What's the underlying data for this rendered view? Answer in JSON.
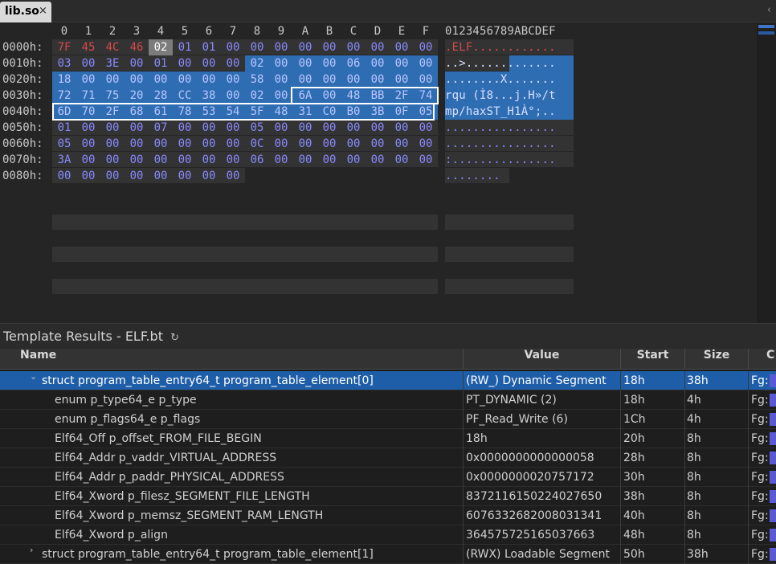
{
  "tab": {
    "title": "lib.so",
    "close": "×",
    "scroll_chevron": "‹"
  },
  "hex": {
    "columns": [
      "0",
      "1",
      "2",
      "3",
      "4",
      "5",
      "6",
      "7",
      "8",
      "9",
      "A",
      "B",
      "C",
      "D",
      "E",
      "F"
    ],
    "ascii_header": "0123456789ABCDEF",
    "rows": [
      {
        "offset": "0000h:",
        "bytes": [
          "7F",
          "45",
          "4C",
          "46",
          "02",
          "01",
          "01",
          "00",
          "00",
          "00",
          "00",
          "00",
          "00",
          "00",
          "00",
          "00"
        ],
        "ascii": ".ELF............"
      },
      {
        "offset": "0010h:",
        "bytes": [
          "03",
          "00",
          "3E",
          "00",
          "01",
          "00",
          "00",
          "00",
          "02",
          "00",
          "00",
          "00",
          "06",
          "00",
          "00",
          "00"
        ],
        "ascii": "..>............."
      },
      {
        "offset": "0020h:",
        "bytes": [
          "18",
          "00",
          "00",
          "00",
          "00",
          "00",
          "00",
          "00",
          "58",
          "00",
          "00",
          "00",
          "00",
          "00",
          "00",
          "00"
        ],
        "ascii": "........X......."
      },
      {
        "offset": "0030h:",
        "bytes": [
          "72",
          "71",
          "75",
          "20",
          "28",
          "CC",
          "38",
          "00",
          "02",
          "00",
          "6A",
          "00",
          "48",
          "BB",
          "2F",
          "74"
        ],
        "ascii": "rqu (Ì8...j.H»/t"
      },
      {
        "offset": "0040h:",
        "bytes": [
          "6D",
          "70",
          "2F",
          "68",
          "61",
          "78",
          "53",
          "54",
          "5F",
          "48",
          "31",
          "C0",
          "B0",
          "3B",
          "0F",
          "05"
        ],
        "ascii": "mp/haxST_H1À°;.."
      },
      {
        "offset": "0050h:",
        "bytes": [
          "01",
          "00",
          "00",
          "00",
          "07",
          "00",
          "00",
          "00",
          "05",
          "00",
          "00",
          "00",
          "00",
          "00",
          "00",
          "00"
        ],
        "ascii": "................"
      },
      {
        "offset": "0060h:",
        "bytes": [
          "05",
          "00",
          "00",
          "00",
          "00",
          "00",
          "00",
          "00",
          "0C",
          "00",
          "00",
          "00",
          "00",
          "00",
          "00",
          "00"
        ],
        "ascii": "................"
      },
      {
        "offset": "0070h:",
        "bytes": [
          "3A",
          "00",
          "00",
          "00",
          "00",
          "00",
          "00",
          "00",
          "06",
          "00",
          "00",
          "00",
          "00",
          "00",
          "00",
          "00"
        ],
        "ascii": ":..............."
      },
      {
        "offset": "0080h:",
        "bytes": [
          "00",
          "00",
          "00",
          "00",
          "00",
          "00",
          "00",
          "00"
        ],
        "ascii": "........"
      }
    ]
  },
  "template_results": {
    "title": "Template Results - ELF.bt",
    "refresh_glyph": "↻",
    "headers": {
      "name": "Name",
      "value": "Value",
      "start": "Start",
      "size": "Size",
      "color": "C"
    },
    "rows": [
      {
        "name": "struct program_table_entry64_t program_table_element[0]",
        "value": "(RW_) Dynamic Segment",
        "start": "18h",
        "size": "38h",
        "color": "Fg:",
        "expander": "⌄"
      },
      {
        "name": "enum p_type64_e p_type",
        "value": "PT_DYNAMIC (2)",
        "start": "18h",
        "size": "4h",
        "color": "Fg:",
        "expander": ""
      },
      {
        "name": "enum p_flags64_e p_flags",
        "value": "PF_Read_Write (6)",
        "start": "1Ch",
        "size": "4h",
        "color": "Fg:",
        "expander": ""
      },
      {
        "name": "Elf64_Off p_offset_FROM_FILE_BEGIN",
        "value": "18h",
        "start": "20h",
        "size": "8h",
        "color": "Fg:",
        "expander": ""
      },
      {
        "name": "Elf64_Addr p_vaddr_VIRTUAL_ADDRESS",
        "value": "0x0000000000000058",
        "start": "28h",
        "size": "8h",
        "color": "Fg:",
        "expander": ""
      },
      {
        "name": "Elf64_Addr p_paddr_PHYSICAL_ADDRESS",
        "value": "0x0000000020757172",
        "start": "30h",
        "size": "8h",
        "color": "Fg:",
        "expander": ""
      },
      {
        "name": "Elf64_Xword p_filesz_SEGMENT_FILE_LENGTH",
        "value": "8372116150224027650",
        "start": "38h",
        "size": "8h",
        "color": "Fg:",
        "expander": ""
      },
      {
        "name": "Elf64_Xword p_memsz_SEGMENT_RAM_LENGTH",
        "value": "6076332682008031341",
        "start": "40h",
        "size": "8h",
        "color": "Fg:",
        "expander": ""
      },
      {
        "name": "Elf64_Xword p_align",
        "value": "364575725165037663",
        "start": "48h",
        "size": "8h",
        "color": "Fg:",
        "expander": ""
      },
      {
        "name": "struct program_table_entry64_t program_table_element[1]",
        "value": "(RWX) Loadable Segment",
        "start": "50h",
        "size": "38h",
        "color": "Fg:",
        "expander": "›"
      }
    ]
  },
  "colors": {
    "selection": "#2f6db3",
    "elf_magic": "#d44a4a",
    "byte_text": "#8a8aff",
    "selected_row": "#1e5ea8"
  }
}
